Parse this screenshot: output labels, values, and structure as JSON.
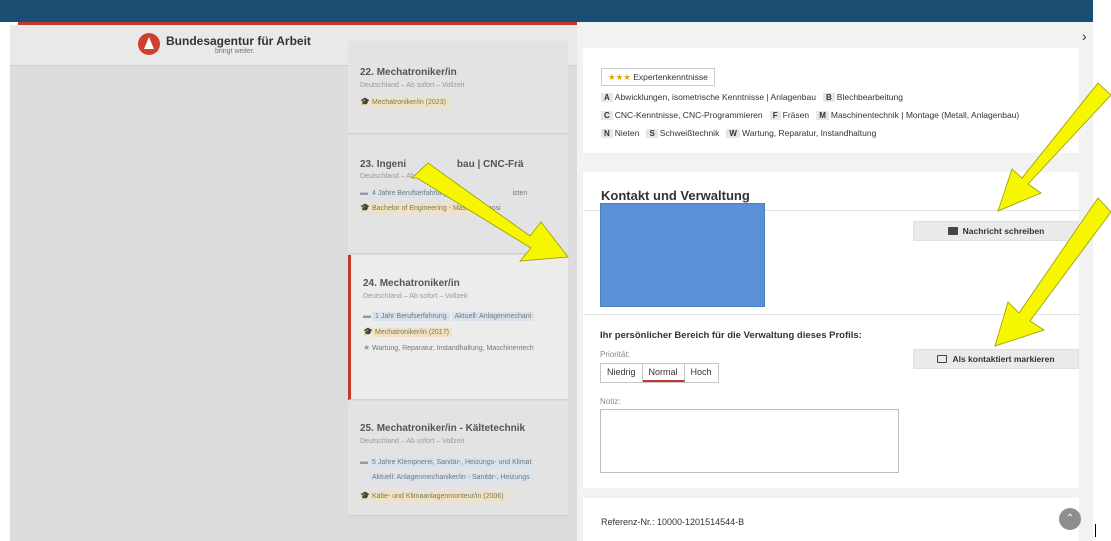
{
  "colors": {
    "topbar": "#1a4f73",
    "accent": "#c0392b",
    "arrow": "#f6f600",
    "avatar": "#5b8fd6"
  },
  "header": {
    "logo_title": "Bundesagentur für Arbeit",
    "logo_sub": "bringt weiter."
  },
  "list": [
    {
      "num": "22.",
      "title": "Mechatroniker/in",
      "meta": "Deutschland – Ab sofort – Vollzeit",
      "rows": [
        {
          "icon": "graduation-icon",
          "parts": [
            "Mechatroniker/in (2023)"
          ]
        }
      ]
    },
    {
      "num": "23.",
      "title": "Ingeni",
      "title_rest": "bau  |  CNC-Frä",
      "meta": "Deutschland – Ab",
      "rows": [
        {
          "icon": "briefcase-icon",
          "parts": [
            "4 Jahre Berufserfahrung",
            "isten"
          ]
        },
        {
          "icon": "graduation-icon",
          "parts": [
            "Bachelor of Engineering - Maschine",
            "posi"
          ]
        }
      ]
    },
    {
      "num": "24.",
      "title": "Mechatroniker/in",
      "meta": "Deutschland – Ab sofort – Vollzeit",
      "rows": [
        {
          "icon": "briefcase-icon",
          "parts": [
            "1 Jahr Berufserfahrung",
            "Aktuell: Anlagenmechani"
          ]
        },
        {
          "icon": "graduation-icon",
          "parts": [
            "Mechatroniker/in (2017)"
          ]
        },
        {
          "icon": "star-icon",
          "parts": [
            "Wartung, Reparatur, Instandhaltung, Maschinentech"
          ]
        }
      ]
    },
    {
      "num": "25.",
      "title": "Mechatroniker/in - Kältetechnik",
      "meta": "Deutschland – Ab sofort – Vollzeit",
      "rows": [
        {
          "icon": "briefcase-icon",
          "parts": [
            "5 Jahre Klempnerei, Sanitär-, Heizungs- und Klimat"
          ]
        },
        {
          "icon": "",
          "parts": [
            "Aktuell: Anlagenmechaniker/in - Sanitär-, Heizungs"
          ]
        },
        {
          "icon": "graduation-icon",
          "parts": [
            "Kälte- und Klimaanlagenmonteur/in (2006)"
          ]
        }
      ]
    }
  ],
  "panel": {
    "close_glyph": "›",
    "stars": "★★★",
    "expert_label": "Expertenkenntnisse",
    "skill_lines": [
      [
        {
          "letter": "A",
          "text": "Abwicklungen, isometrische Kenntnisse | Anlagenbau"
        },
        {
          "letter": "B",
          "text": "Blechbearbeitung"
        }
      ],
      [
        {
          "letter": "C",
          "text": "CNC-Kenntnisse, CNC-Programmieren"
        },
        {
          "letter": "F",
          "text": "Fräsen"
        },
        {
          "letter": "M",
          "text": "Maschinentechnik | Montage (Metall, Anlagenbau)"
        }
      ],
      [
        {
          "letter": "N",
          "text": "Nieten"
        },
        {
          "letter": "S",
          "text": "Schweißtechnik"
        },
        {
          "letter": "W",
          "text": "Wartung, Reparatur, Instandhaltung"
        }
      ]
    ],
    "kontakt_title": "Kontakt und Verwaltung",
    "message_button": "Nachricht schreiben",
    "bereich_title": "Ihr persönlicher Bereich für die Verwaltung dieses Profils:",
    "priority_label": "Priorität:",
    "priority_options": [
      "Niedrig",
      "Normal",
      "Hoch"
    ],
    "priority_selected": "Normal",
    "mark_button": "Als kontaktiert markieren",
    "notiz_label": "Notiz:",
    "notiz_value": "",
    "reference": "Referenz-Nr.: 10000-1201514544-B",
    "scroll_top_glyph": "⌃"
  }
}
